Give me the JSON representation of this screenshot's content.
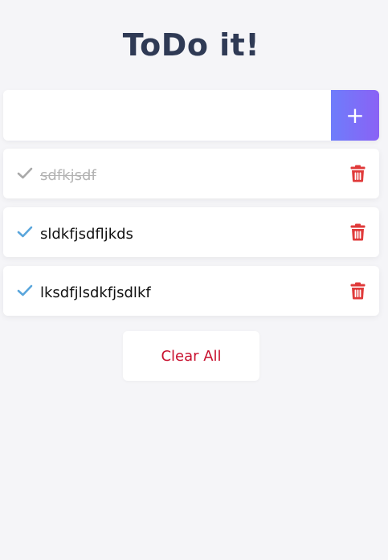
{
  "header": {
    "title": "ToDo it!"
  },
  "new_todo": {
    "value": "",
    "placeholder": "",
    "add_label": "+"
  },
  "todos": [
    {
      "text": "sdfkjsdf",
      "completed": true
    },
    {
      "text": "sldkfjsdfljkds",
      "completed": false
    },
    {
      "text": "lksdfjlsdkfjsdlkf",
      "completed": false
    }
  ],
  "footer": {
    "clear_label": "Clear All"
  },
  "colors": {
    "title": "#2f3a55",
    "accent_start": "#6e7dfb",
    "accent_end": "#8a62f5",
    "check_active": "#5aa6dc",
    "check_done": "#a9a9a9",
    "trash": "#e03a3a",
    "clear_text": "#c8102e",
    "background": "#f5f5f8"
  },
  "icons": {
    "check": "check-icon",
    "trash": "trash-icon"
  }
}
